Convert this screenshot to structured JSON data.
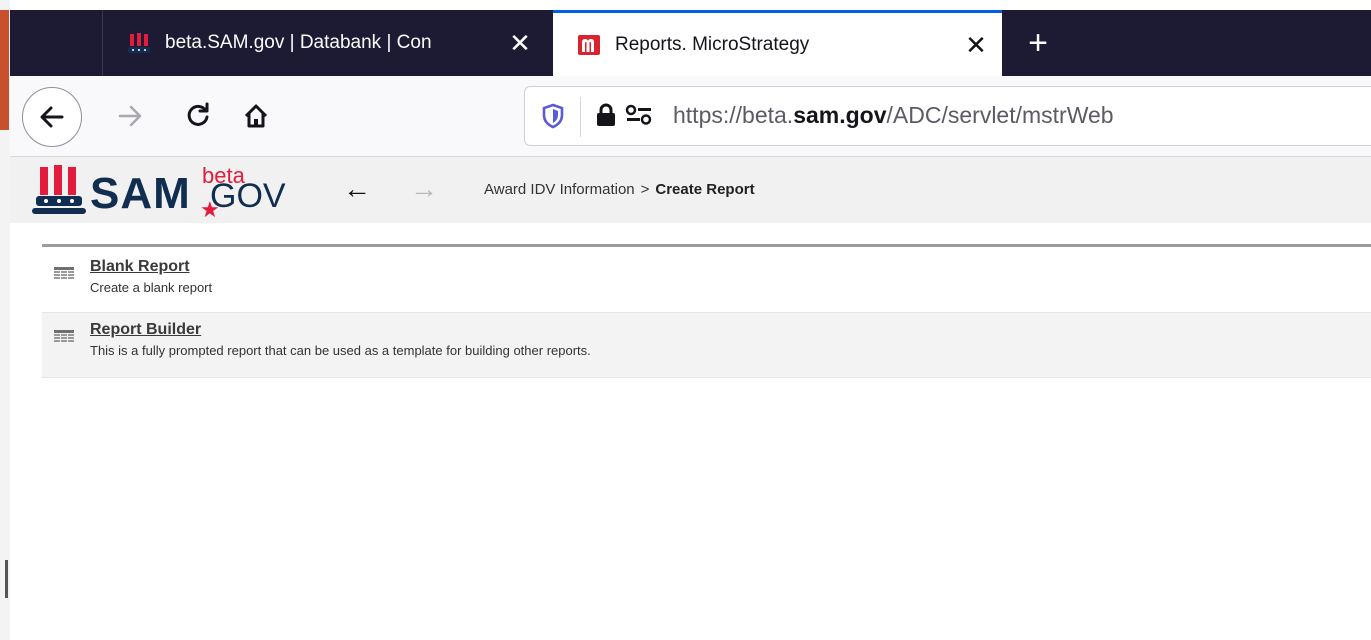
{
  "browser": {
    "tabs": [
      {
        "title": "beta.SAM.gov | Databank | Con",
        "close": "✕",
        "active": false
      },
      {
        "title": "Reports. MicroStrategy",
        "close": "✕",
        "active": true
      }
    ],
    "new_tab": "+",
    "url_prefix": "https://beta.",
    "url_domain": "sam.gov",
    "url_path": "/ADC/servlet/mstrWeb"
  },
  "header": {
    "logo_sam": "SAM",
    "logo_beta": "beta",
    "logo_gov": "GOV",
    "logo_dot": "★",
    "back_arrow": "←",
    "forward_arrow": "→",
    "breadcrumb_parent": "Award IDV Information",
    "breadcrumb_separator": ">",
    "breadcrumb_current": "Create Report"
  },
  "reports": [
    {
      "name": "Blank Report",
      "description": "Create a blank report"
    },
    {
      "name": "Report Builder",
      "description": "This is a fully prompted report that can be used as a template for building other reports."
    }
  ],
  "colors": {
    "tabbar": "#1c1b33",
    "active_tab_accent": "#0060df",
    "sam_navy": "#112e51",
    "sam_red": "#e31c3d"
  }
}
